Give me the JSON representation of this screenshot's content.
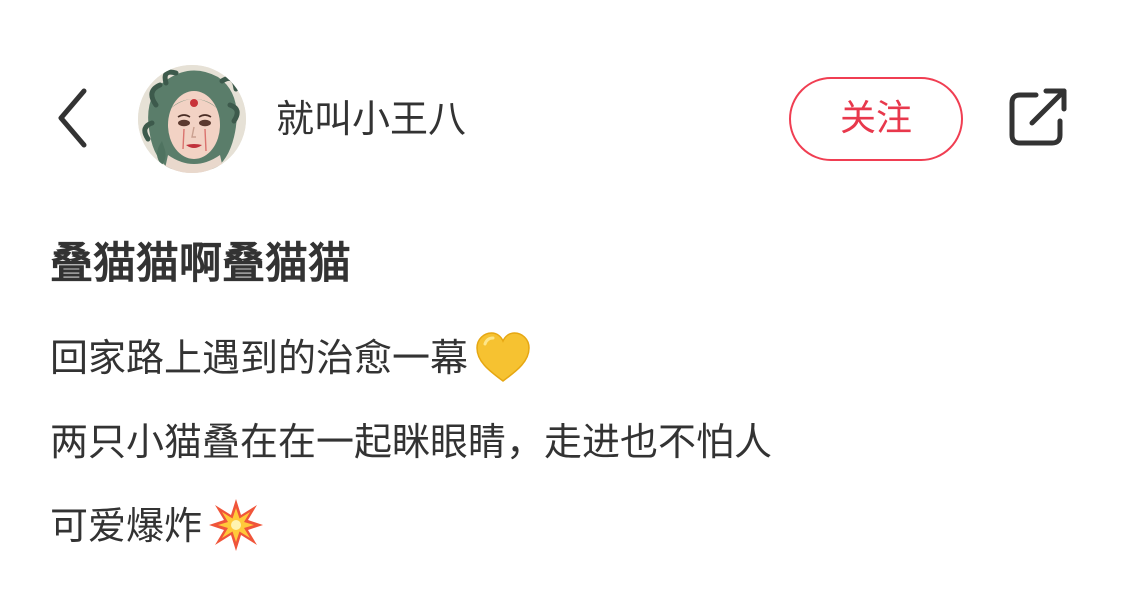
{
  "header": {
    "back_icon": "chevron-left-icon",
    "avatar_icon": "user-avatar",
    "username": "就叫小王八",
    "follow_label": "关注",
    "share_icon": "share-external-icon"
  },
  "note": {
    "title": "叠猫猫啊叠猫猫",
    "lines": [
      {
        "text": "回家路上遇到的治愈一幕",
        "emoji": "yellow-heart-icon"
      },
      {
        "text": "两只小猫叠在在一起眯眼睛，走进也不怕人"
      },
      {
        "text": "可爱爆炸",
        "emoji": "collision-icon"
      }
    ]
  },
  "colors": {
    "accent": "#e8384c",
    "text": "#333333",
    "icon": "#333333",
    "heart": "#f6c231",
    "background": "#ffffff"
  }
}
